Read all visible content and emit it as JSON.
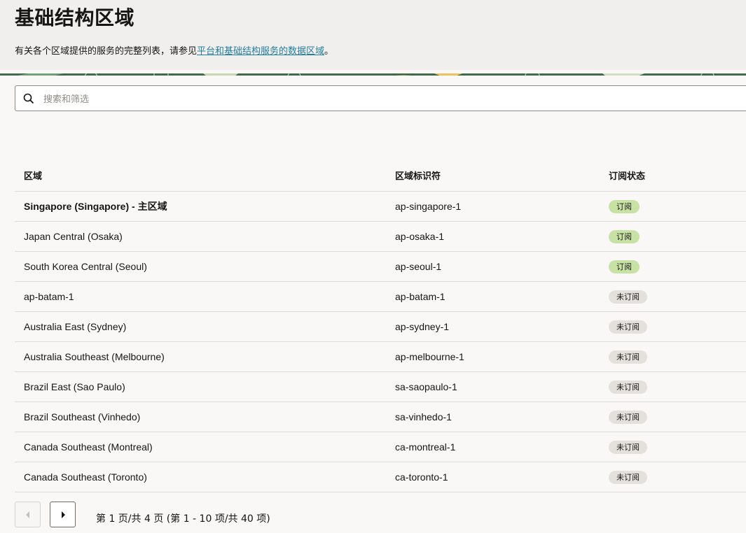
{
  "header": {
    "title": "基础结构区域",
    "desc_prefix": "有关各个区域提供的服务的完整列表，请参见",
    "desc_link": "平台和基础结构服务的数据区域",
    "desc_suffix": "。"
  },
  "search": {
    "placeholder": "搜索和筛选",
    "value": ""
  },
  "table": {
    "headers": [
      "区域",
      "区域标识符",
      "订阅状态"
    ],
    "rows": [
      {
        "region": "Singapore (Singapore) - 主区域",
        "id": "ap-singapore-1",
        "status": "订阅",
        "subscribed": true
      },
      {
        "region": "Japan Central (Osaka)",
        "id": "ap-osaka-1",
        "status": "订阅",
        "subscribed": true
      },
      {
        "region": "South Korea Central (Seoul)",
        "id": "ap-seoul-1",
        "status": "订阅",
        "subscribed": true
      },
      {
        "region": "ap-batam-1",
        "id": "ap-batam-1",
        "status": "未订阅",
        "subscribed": false
      },
      {
        "region": "Australia East (Sydney)",
        "id": "ap-sydney-1",
        "status": "未订阅",
        "subscribed": false
      },
      {
        "region": "Australia Southeast (Melbourne)",
        "id": "ap-melbourne-1",
        "status": "未订阅",
        "subscribed": false
      },
      {
        "region": "Brazil East (Sao Paulo)",
        "id": "sa-saopaulo-1",
        "status": "未订阅",
        "subscribed": false
      },
      {
        "region": "Brazil Southeast (Vinhedo)",
        "id": "sa-vinhedo-1",
        "status": "未订阅",
        "subscribed": false
      },
      {
        "region": "Canada Southeast (Montreal)",
        "id": "ca-montreal-1",
        "status": "未订阅",
        "subscribed": false
      },
      {
        "region": "Canada Southeast (Toronto)",
        "id": "ca-toronto-1",
        "status": "未订阅",
        "subscribed": false
      }
    ]
  },
  "pagination": {
    "info": "第 1 页/共 4 页 (第 1 - 10 项/共 40 项)",
    "current_page": 1,
    "total_pages": 4
  },
  "colors": {
    "subscribed_badge": "#c8e2a6",
    "unsubscribed_badge": "#e4e1dd",
    "link": "#227e9e"
  }
}
